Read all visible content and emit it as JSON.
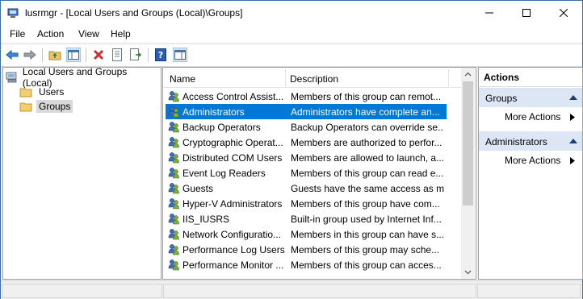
{
  "window": {
    "title": "lusrmgr - [Local Users and Groups (Local)\\Groups]",
    "controls": {
      "minimize": "minimize-icon",
      "maximize": "maximize-icon",
      "close": "close-icon"
    }
  },
  "menu": {
    "items": [
      "File",
      "Action",
      "View",
      "Help"
    ]
  },
  "toolbar": {
    "icons": [
      "back-arrow-icon",
      "forward-arrow-icon",
      "up-folder-icon",
      "show-hide-tree-icon",
      "delete-icon",
      "properties-icon",
      "export-list-icon",
      "help-icon",
      "show-hide-action-pane-icon"
    ]
  },
  "tree": {
    "root": "Local Users and Groups (Local)",
    "items": [
      "Users",
      "Groups"
    ],
    "selected": "Groups"
  },
  "list": {
    "columns": [
      "Name",
      "Description"
    ],
    "rows": [
      {
        "name": "Access Control Assist...",
        "description": "Members of this group can remot..."
      },
      {
        "name": "Administrators",
        "description": "Administrators have complete an..."
      },
      {
        "name": "Backup Operators",
        "description": "Backup Operators can override se..."
      },
      {
        "name": "Cryptographic Operat...",
        "description": "Members are authorized to perfor..."
      },
      {
        "name": "Distributed COM Users",
        "description": "Members are allowed to launch, a..."
      },
      {
        "name": "Event Log Readers",
        "description": "Members of this group can read e..."
      },
      {
        "name": "Guests",
        "description": "Guests have the same access as m..."
      },
      {
        "name": "Hyper-V Administrators",
        "description": "Members of this group have com..."
      },
      {
        "name": "IIS_IUSRS",
        "description": "Built-in group used by Internet Inf..."
      },
      {
        "name": "Network Configuratio...",
        "description": "Members in this group can have s..."
      },
      {
        "name": "Performance Log Users",
        "description": "Members of this group may sche..."
      },
      {
        "name": "Performance Monitor ...",
        "description": "Members of this group can acces..."
      }
    ],
    "selected_index": 1
  },
  "actions": {
    "title": "Actions",
    "sections": [
      {
        "header": "Groups",
        "items": [
          "More Actions"
        ]
      },
      {
        "header": "Administrators",
        "items": [
          "More Actions"
        ]
      }
    ]
  },
  "colors": {
    "selection": "#0078d7",
    "action_header": "#dce6f4",
    "tree_selection": "#d9d9d9"
  }
}
